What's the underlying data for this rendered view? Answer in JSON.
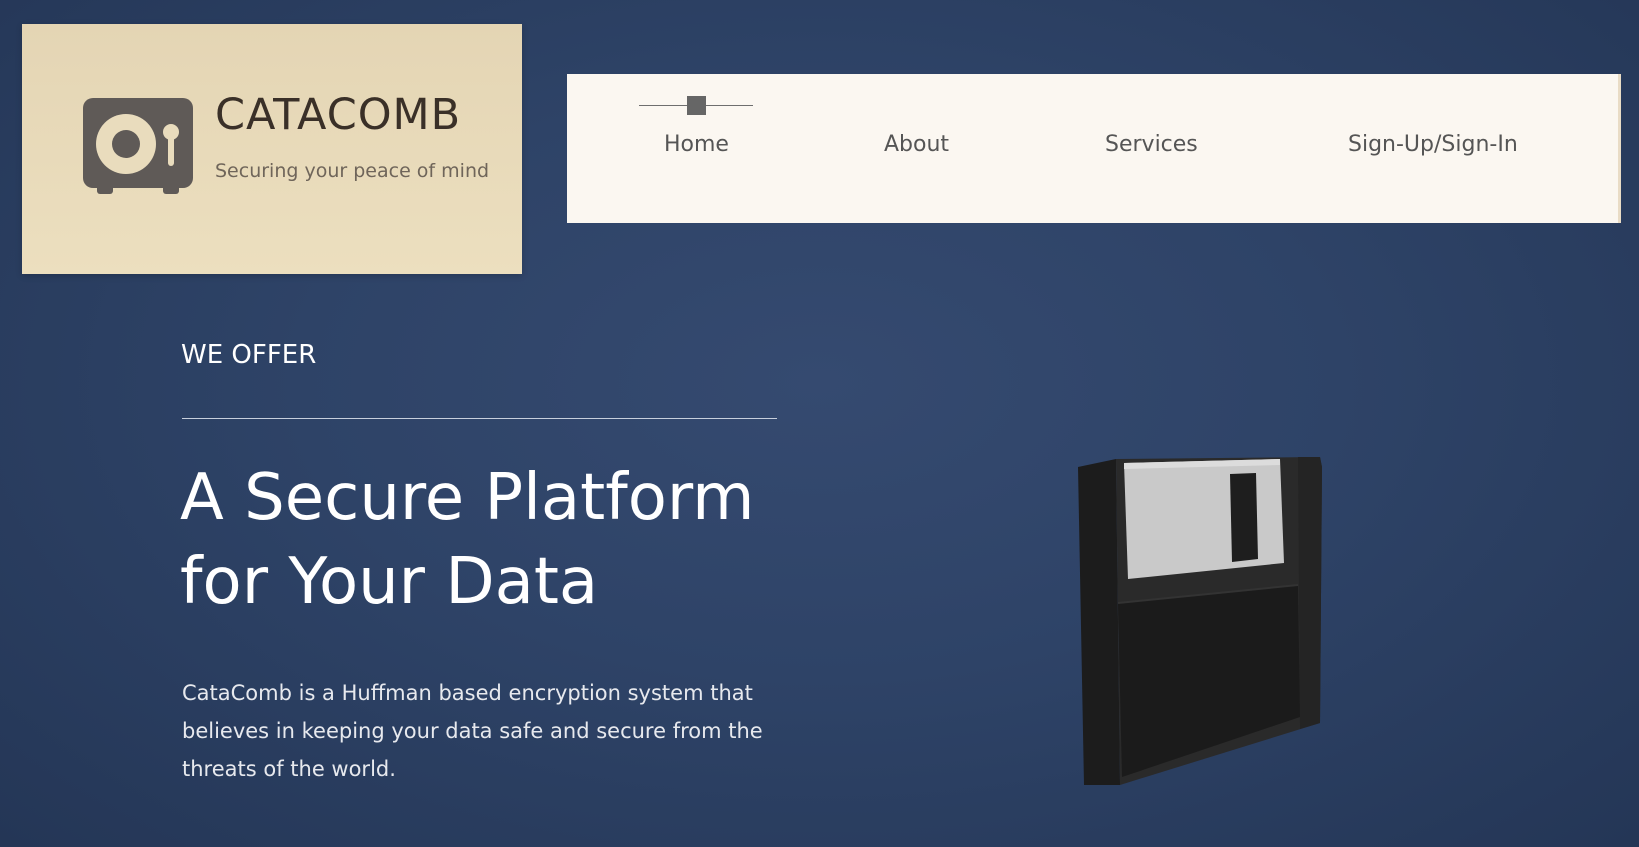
{
  "brand": {
    "name": "CATACOMB",
    "tagline": "Securing your peace of mind",
    "logo_icon": "safe-icon"
  },
  "nav": {
    "items": [
      {
        "label": "Home",
        "active": true
      },
      {
        "label": "About",
        "active": false
      },
      {
        "label": "Services",
        "active": false
      },
      {
        "label": "Sign-Up/Sign-In",
        "active": false
      }
    ]
  },
  "hero": {
    "eyebrow": "WE OFFER",
    "title_line1": "A Secure Platform",
    "title_line2": "for Your Data",
    "description": "CataComb is a Huffman based encryption system that believes in keeping your data safe and secure from the threats of the world.",
    "illustration": "floppy-disk-icon"
  },
  "colors": {
    "background": "#2e4367",
    "logo_card": "#e8dabb",
    "nav_bar": "#fbf7f1",
    "text_light": "#ffffff",
    "nav_text": "#555555"
  }
}
